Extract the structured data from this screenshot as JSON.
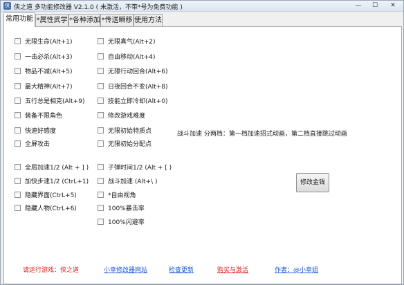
{
  "window": {
    "title": "侠之道 多功能修改器  V2.1.0  ( 未激活，不带*号为免费功能 )",
    "minimize_glyph": "—",
    "maximize_glyph": "☐",
    "close_glyph": "✕"
  },
  "tabs": [
    "常用功能",
    "*属性武学",
    "*各种添加",
    "*传送瞬移",
    "使用方法"
  ],
  "left_column": [
    "无限生命(Alt+1)",
    "一击必杀(Alt+3)",
    "物品不减(Alt+5)",
    "最大精神(Alt+7)",
    "五行总是相克(Alt+9)",
    "装备不限角色",
    "快速好感度",
    "全屏攻击",
    "全局加速1/2 (Alt + ] )",
    "加快步速1/2 (CtrL+1)",
    "隐藏界面(CtrL+5)",
    "隐藏人物(CtrL+6)"
  ],
  "right_column": [
    "无限真气(Alt+2)",
    "自由移动(Alt+4)",
    "无限行动回合(Alt+6)",
    "日夜回合不变(Alt+8)",
    "技能立即冷却(Alt+0)",
    "修改游戏难度",
    "无限初始特质点",
    "无限初始分配点",
    "子弹时间1/2 (Alt + [ )",
    "战斗加速 (Alt+\\ )",
    "*自由视角",
    "100%暴击率",
    "100%闪避率"
  ],
  "note": "战斗加速  分两档：第一档加速招式动画，第二档直接跳过动画",
  "button_label": "修改金钱",
  "footer": {
    "run_game": "请运行游戏：侠之道",
    "website": "小幸修改器网站",
    "check_update": "检查更新",
    "buy_activate": "购买与激活",
    "author": "作者：@小幸姐"
  },
  "colors": {
    "footer_red": "#e02020",
    "link_blue": "#1a5bd6"
  }
}
